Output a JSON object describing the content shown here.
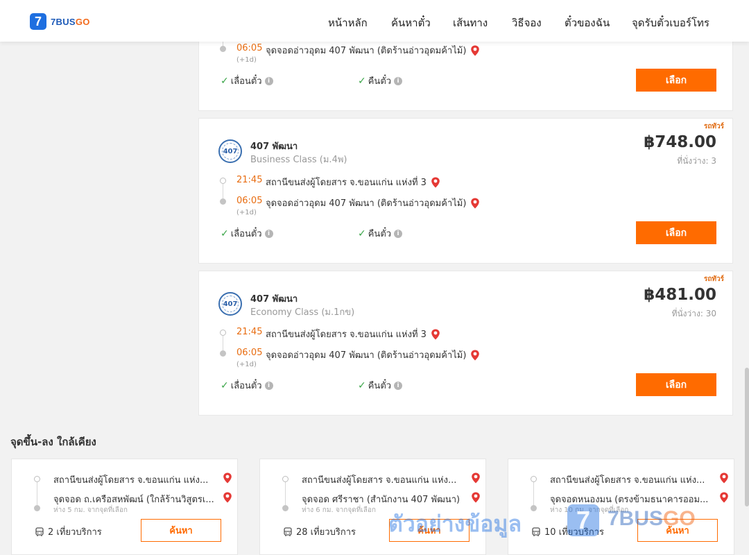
{
  "header": {
    "logo_mark": "7",
    "logo_text_main": "7BUS",
    "logo_text_go": "GO",
    "nav": [
      "หน้าหลัก",
      "ค้นหาตั๋ว",
      "เส้นทาง",
      "วิธีจอง",
      "ตั๋วของฉัน",
      "จุดรับตั๋วเบอร์โทร"
    ]
  },
  "trips": [
    {
      "arrive_time": "06:05",
      "arrive_place": "จุดจอดอ่าวอุดม 407 พัฒนา (ติดร้านอ่าวอุดมค้าไม้)",
      "next_day": "(+1d)",
      "feature_1": "เลื่อนตั๋ว",
      "feature_2": "คืนตั๋ว",
      "select_label": "เลือก"
    },
    {
      "tag": "รถทัวร์",
      "logo": "407",
      "operator": "407 พัฒนา",
      "bus_class": "Business Class (ม.4พ)",
      "price": "฿748.00",
      "seats": "ที่นั่งว่าง: 3",
      "depart_time": "21:45",
      "depart_place": "สถานีขนส่งผู้โดยสาร จ.ขอนแก่น แห่งที่ 3",
      "arrive_time": "06:05",
      "arrive_place": "จุดจอดอ่าวอุดม 407 พัฒนา (ติดร้านอ่าวอุดมค้าไม้)",
      "next_day": "(+1d)",
      "feature_1": "เลื่อนตั๋ว",
      "feature_2": "คืนตั๋ว",
      "select_label": "เลือก"
    },
    {
      "tag": "รถทัวร์",
      "logo": "407",
      "operator": "407 พัฒนา",
      "bus_class": "Economy Class (ม.1กข)",
      "price": "฿481.00",
      "seats": "ที่นั่งว่าง: 30",
      "depart_time": "21:45",
      "depart_place": "สถานีขนส่งผู้โดยสาร จ.ขอนแก่น แห่งที่ 3",
      "arrive_time": "06:05",
      "arrive_place": "จุดจอดอ่าวอุดม 407 พัฒนา (ติดร้านอ่าวอุดมค้าไม้)",
      "next_day": "(+1d)",
      "feature_1": "เลื่อนตั๋ว",
      "feature_2": "คืนตั๋ว",
      "select_label": "เลือก"
    }
  ],
  "nearby": {
    "title": "จุดขึ้น-ลง ใกล้เคียง",
    "cards": [
      {
        "from": "สถานีขนส่งผู้โดยสาร จ.ขอนแก่น แห่ง...",
        "to": "จุดจอด ถ.เครือสหพัฒน์ (ใกล้ร้านวิสูตรเ...",
        "distance": "ห่าง 5 กม. จากจุดที่เลือก",
        "trips": "2 เที่ยวบริการ",
        "button": "ค้นหา"
      },
      {
        "from": "สถานีขนส่งผู้โดยสาร จ.ขอนแก่น แห่ง...",
        "to": "จุดจอด ศรีราชา (สำนักงาน 407 พัฒนา)",
        "distance": "ห่าง 6 กม. จากจุดที่เลือก",
        "trips": "28 เที่ยวบริการ",
        "button": "ค้นหา"
      },
      {
        "from": "สถานีขนส่งผู้โดยสาร จ.ขอนแก่น แห่ง...",
        "to": "จุดจอดหนองมน (ตรงข้ามธนาคารออม...",
        "distance": "ห่าง 10 กม. จากจุดที่เลือก",
        "trips": "10 เที่ยวบริการ",
        "button": "ค้นหา"
      }
    ]
  },
  "watermark": {
    "text": "ตัวอย่างข้อมูล",
    "badge": "7",
    "brand_main": "7BUS",
    "brand_go": "GO"
  },
  "colors": {
    "accent": "#ff6b00",
    "time": "#e86c10",
    "check": "#3aa548",
    "pin": "#e53935",
    "brand_blue": "#1e6fe0"
  }
}
